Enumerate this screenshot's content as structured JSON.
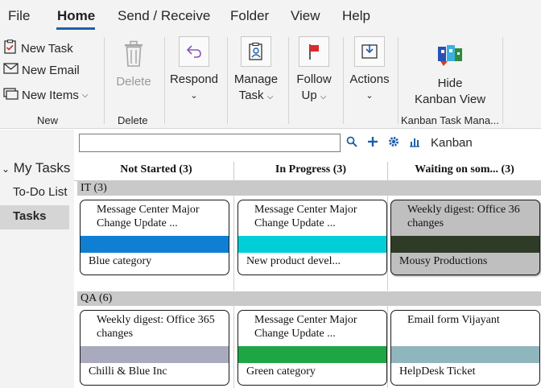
{
  "menu": {
    "items": [
      "File",
      "Home",
      "Send / Receive",
      "Folder",
      "View",
      "Help"
    ],
    "active": "Home"
  },
  "ribbon": {
    "new_group": {
      "new_task": "New Task",
      "new_email": "New Email",
      "new_items": "New Items",
      "label": "New"
    },
    "delete_group": {
      "delete": "Delete",
      "label": "Delete"
    },
    "respond": "Respond",
    "manage_task_1": "Manage",
    "manage_task_2": "Task",
    "follow_up_1": "Follow",
    "follow_up_2": "Up",
    "actions": "Actions",
    "kanban_group": {
      "hide_1": "Hide",
      "hide_2": "Kanban View",
      "label": "Kanban Task Mana..."
    }
  },
  "nav": {
    "header": "My Tasks",
    "items": [
      "To-Do List",
      "Tasks"
    ],
    "selected": "Tasks"
  },
  "toolbar": {
    "search_value": "",
    "view_name": "Kanban"
  },
  "columns": [
    "Not Started (3)",
    "In Progress (3)",
    "Waiting on som... (3)"
  ],
  "groups": [
    {
      "name": "IT (3)",
      "cards": [
        {
          "title": "Message Center Major Change Update ...",
          "category": "Blue category",
          "color": "#0f7fd4"
        },
        {
          "title": "Message Center Major Change Update ...",
          "category": "New product devel...",
          "color": "#00cfd8"
        },
        {
          "title": "Weekly digest: Office 36 changes",
          "category": "Mousy Productions",
          "color": "#2e3b26"
        }
      ]
    },
    {
      "name": "QA (6)",
      "cards": [
        {
          "title": "Weekly digest: Office 365 changes",
          "category": "Chilli & Blue Inc",
          "color": "#aaaabf"
        },
        {
          "title": "Message Center Major Change Update ...",
          "category": "Green category",
          "color": "#1ea645"
        },
        {
          "title": "Email form Vijayant",
          "category": "HelpDesk Ticket",
          "color": "#8fb5bd"
        }
      ]
    }
  ]
}
